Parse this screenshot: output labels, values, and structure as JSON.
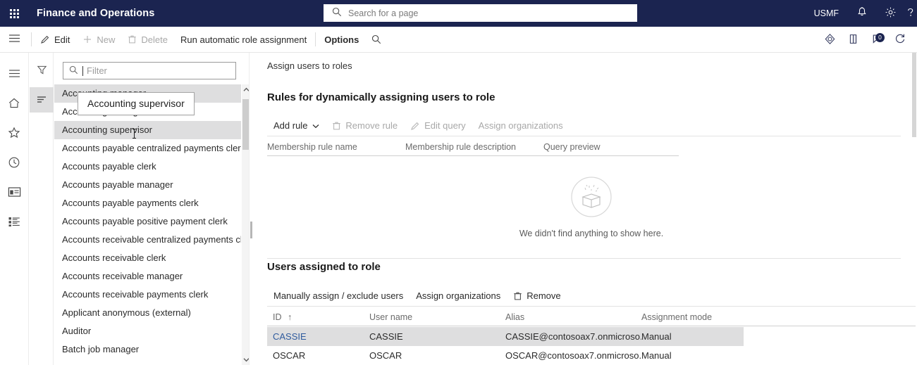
{
  "topbar": {
    "waffle_label": "App launcher",
    "app_title": "Finance and Operations",
    "search_placeholder": "Search for a page",
    "search_value": "",
    "company": "USMF",
    "icons": [
      "bell-icon",
      "gear-icon",
      "help-icon"
    ]
  },
  "commandbar": {
    "buttons": [
      {
        "label": "Edit",
        "icon": "pencil-icon",
        "disabled": false
      },
      {
        "label": "New",
        "icon": "plus-icon",
        "disabled": true
      },
      {
        "label": "Delete",
        "icon": "trash-icon",
        "disabled": true
      },
      {
        "label": "Run automatic role assignment",
        "icon": "",
        "disabled": false
      },
      {
        "label": "Options",
        "icon": "",
        "disabled": false
      }
    ],
    "search_icon": "search-icon",
    "right_icons": [
      "personalize-icon",
      "attachment-icon",
      "messages-icon",
      "refresh-icon"
    ],
    "messages_badge": "0"
  },
  "navrail": {
    "items": [
      {
        "name": "expand-nav",
        "icon": "hamburger-icon"
      },
      {
        "name": "home",
        "icon": "home-icon"
      },
      {
        "name": "favorites",
        "icon": "star-icon"
      },
      {
        "name": "recent",
        "icon": "clock-icon"
      },
      {
        "name": "workspaces",
        "icon": "workspace-icon"
      },
      {
        "name": "modules",
        "icon": "modules-icon"
      }
    ]
  },
  "listpane": {
    "subrail": [
      {
        "name": "filter-pane-toggle",
        "icon": "funnel-icon",
        "active": false
      },
      {
        "name": "list-pane-toggle",
        "icon": "list-icon",
        "active": true
      }
    ],
    "filter": {
      "placeholder": "Filter",
      "value": ""
    },
    "tooltip": "Accounting supervisor",
    "roles": [
      {
        "label": "Accounting manager",
        "state": "selected"
      },
      {
        "label": "Accounting manager",
        "state": "normal"
      },
      {
        "label": "Accounting supervisor",
        "state": "hover"
      },
      {
        "label": "Accounts payable centralized payments clerk",
        "state": "normal"
      },
      {
        "label": "Accounts payable clerk",
        "state": "normal"
      },
      {
        "label": "Accounts payable manager",
        "state": "normal"
      },
      {
        "label": "Accounts payable payments clerk",
        "state": "normal"
      },
      {
        "label": "Accounts payable positive payment clerk",
        "state": "normal"
      },
      {
        "label": "Accounts receivable centralized payments clerk",
        "state": "normal"
      },
      {
        "label": "Accounts receivable clerk",
        "state": "normal"
      },
      {
        "label": "Accounts receivable manager",
        "state": "normal"
      },
      {
        "label": "Accounts receivable payments clerk",
        "state": "normal"
      },
      {
        "label": "Applicant anonymous (external)",
        "state": "normal"
      },
      {
        "label": "Auditor",
        "state": "normal"
      },
      {
        "label": "Batch job manager",
        "state": "normal"
      }
    ]
  },
  "main": {
    "page_caption": "Assign users to roles",
    "rules_section": {
      "title": "Rules for dynamically assigning users to role",
      "toolbar": [
        {
          "label": "Add rule",
          "icon": "",
          "disabled": false,
          "caret": true
        },
        {
          "label": "Remove rule",
          "icon": "trash-icon",
          "disabled": true,
          "caret": false
        },
        {
          "label": "Edit query",
          "icon": "pencil-icon",
          "disabled": true,
          "caret": false
        },
        {
          "label": "Assign organizations",
          "icon": "",
          "disabled": true,
          "caret": false
        }
      ],
      "columns": [
        "Membership rule name",
        "Membership rule description",
        "Query preview"
      ],
      "empty_state": {
        "icon": "empty-box-icon",
        "message": "We didn't find anything to show here."
      }
    },
    "users_section": {
      "title": "Users assigned to role",
      "toolbar": [
        {
          "label": "Manually assign / exclude users",
          "icon": "",
          "disabled": false
        },
        {
          "label": "Assign organizations",
          "icon": "",
          "disabled": false
        },
        {
          "label": "Remove",
          "icon": "trash-icon",
          "disabled": false
        }
      ],
      "columns": [
        {
          "label": "ID",
          "sort": "↑"
        },
        {
          "label": "User name",
          "sort": ""
        },
        {
          "label": "Alias",
          "sort": ""
        },
        {
          "label": "Assignment mode",
          "sort": ""
        }
      ],
      "rows": [
        {
          "id": "CASSIE",
          "user_name": "CASSIE",
          "alias": "CASSIE@contosoax7.onmicroso...",
          "assignment_mode": "Manual",
          "selected": true
        },
        {
          "id": "OSCAR",
          "user_name": "OSCAR",
          "alias": "OSCAR@contosoax7.onmicroso...",
          "assignment_mode": "Manual",
          "selected": false
        }
      ]
    }
  },
  "colors": {
    "topbar_bg": "#1b2450",
    "selection": "#dededf",
    "link": "#2f5b9e",
    "disabled_text": "#a8a8a8"
  }
}
